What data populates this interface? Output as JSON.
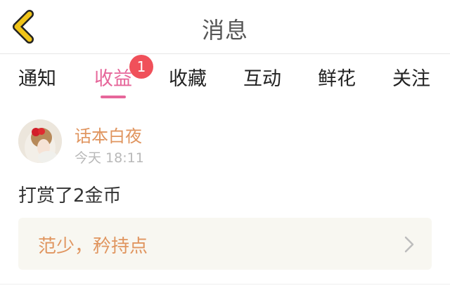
{
  "header": {
    "title": "消息"
  },
  "tabs": [
    {
      "label": "通知"
    },
    {
      "label": "收益",
      "active": true,
      "badge": "1"
    },
    {
      "label": "收藏"
    },
    {
      "label": "互动"
    },
    {
      "label": "鲜花"
    },
    {
      "label": "关注"
    }
  ],
  "message": {
    "username": "话本白夜",
    "time": "今天 18:11",
    "content": "打赏了2金币",
    "reply": "范少，矜持点"
  },
  "colors": {
    "accent": "#e6669a",
    "badge": "#f0505a",
    "username": "#e0955f",
    "back": "#f0c419"
  },
  "icons": {
    "back": "chevron-left-icon",
    "reply": "chevron-right-icon"
  }
}
